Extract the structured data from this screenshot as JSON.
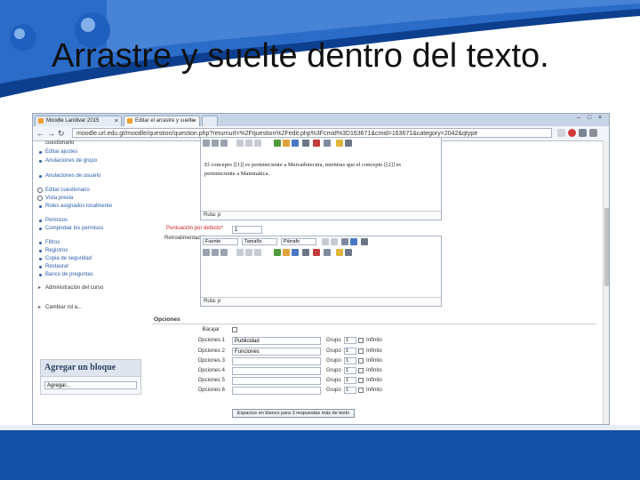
{
  "slide": {
    "title": "Arrastre y suelte dentro del texto."
  },
  "colors": {
    "deco_dark": "#0d3f8f",
    "deco_light": "#2b6cc8",
    "link": "#2a5caa"
  },
  "browser": {
    "tabs": [
      {
        "label": "Moodle Landivar 2015"
      },
      {
        "label": "Editar el arrastre y suelte"
      }
    ],
    "url": "moodle.url.edu.gt/moodle/question/question.php?returnurl=%2Fquestion%2Fedit.php%3Fcmid%3D163671&cmid=163671&category=2042&qtype",
    "nav_icons": [
      "back-icon",
      "forward-icon",
      "reload-icon"
    ]
  },
  "sidebar": {
    "top_label": "cuestionario",
    "items": [
      {
        "label": "Editar ajustes"
      },
      {
        "label": "Anulaciones de grupo"
      },
      {
        "label": "Anulaciones de usuario"
      },
      {
        "label": "Editar cuestionario"
      },
      {
        "label": "Vista previa"
      },
      {
        "label": "Roles asignados localmente"
      },
      {
        "label": "Permisos"
      },
      {
        "label": "Comprobar los permisos"
      },
      {
        "label": "Filtros"
      },
      {
        "label": "Registros"
      },
      {
        "label": "Copia de seguridad"
      },
      {
        "label": "Restaurar"
      },
      {
        "label": "Banco de preguntas"
      }
    ],
    "categories": [
      {
        "label": "Administración del curso"
      },
      {
        "label": "Cambiar rol a..."
      }
    ],
    "add_block": {
      "title": "Agregar un bloque",
      "select": "Agregar..."
    }
  },
  "form": {
    "question_text": "El concepto [[1]] es perteneciente a Mercadotecnia, mientras que el concepto [[2]] es perteneciente a Matemática.",
    "path_label": "Ruta: p",
    "default_mark_label": "Puntuación por defecto*",
    "default_mark_value": "1",
    "general_feedback_label": "Retroalimentación general",
    "toolbar": {
      "font": "Fuente",
      "size": "Tamaño",
      "paragraph": "Párrafo"
    },
    "options": {
      "heading": "Opciones",
      "shuffle_label": "Barajar",
      "group_label": "Grupo",
      "unlimited_label": "Infinito",
      "rows": [
        {
          "label": "Opciones 1",
          "value": "Publicidad",
          "group": "1"
        },
        {
          "label": "Opciones 2",
          "value": "Funciones",
          "group": "1"
        },
        {
          "label": "Opciones 3",
          "value": "",
          "group": "1"
        },
        {
          "label": "Opciones 4",
          "value": "",
          "group": "1"
        },
        {
          "label": "Opciones 5",
          "value": "",
          "group": "1"
        },
        {
          "label": "Opciones 6",
          "value": "",
          "group": "1"
        }
      ],
      "blanks_button": "Espacios en blanco para 3 respuestas más de texto"
    }
  }
}
